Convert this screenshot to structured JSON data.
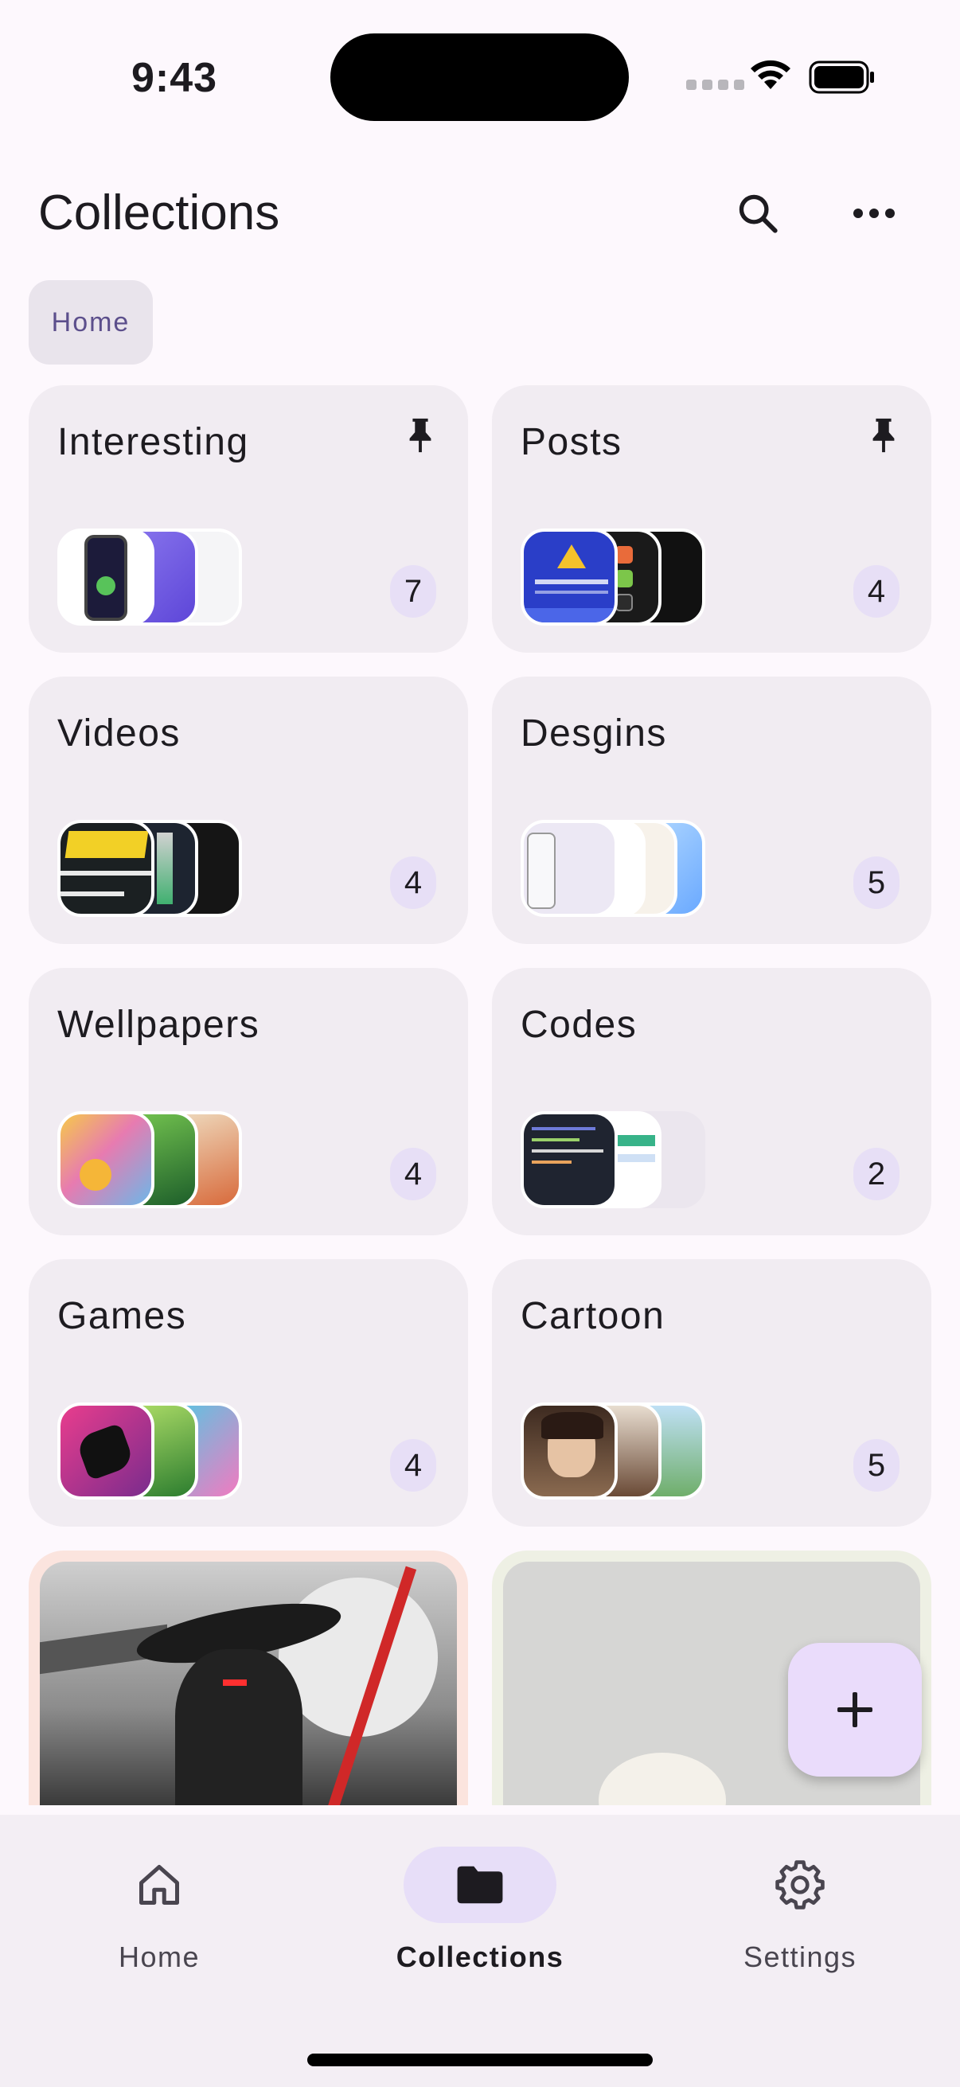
{
  "status": {
    "time": "9:43"
  },
  "header": {
    "title": "Collections"
  },
  "breadcrumb": {
    "label": "Home"
  },
  "collections": [
    {
      "name": "Interesting",
      "count": "7",
      "pinned": true
    },
    {
      "name": "Posts",
      "count": "4",
      "pinned": true
    },
    {
      "name": "Videos",
      "count": "4",
      "pinned": false
    },
    {
      "name": "Desgins",
      "count": "5",
      "pinned": false
    },
    {
      "name": "Wellpapers",
      "count": "4",
      "pinned": false
    },
    {
      "name": "Codes",
      "count": "2",
      "pinned": false
    },
    {
      "name": "Games",
      "count": "4",
      "pinned": false
    },
    {
      "name": "Cartoon",
      "count": "5",
      "pinned": false
    }
  ],
  "nav": {
    "items": [
      {
        "label": "Home",
        "icon": "home-icon",
        "active": false
      },
      {
        "label": "Collections",
        "icon": "folder-icon",
        "active": true
      },
      {
        "label": "Settings",
        "icon": "gear-icon",
        "active": false
      }
    ]
  },
  "colors": {
    "accent": "#e7def8",
    "card": "#f1ecf2",
    "fab": "#eadcfb"
  }
}
